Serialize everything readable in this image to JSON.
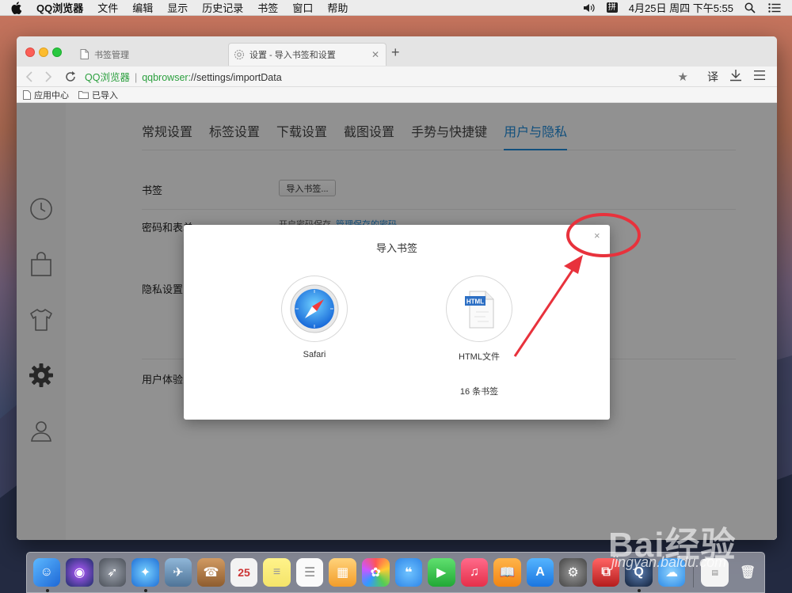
{
  "menubar": {
    "app": "QQ浏览器",
    "menus": [
      "文件",
      "编辑",
      "显示",
      "历史记录",
      "书签",
      "窗口",
      "帮助"
    ],
    "input_method": "拼",
    "clock": "4月25日 周四 下午5:55"
  },
  "tabs": [
    {
      "label": "书签管理",
      "active": false
    },
    {
      "label": "设置 - 导入书签和设置",
      "active": true
    }
  ],
  "toolbar": {
    "site_identity": "QQ浏览器",
    "url_scheme": "qqbrowser:",
    "url_path": "//settings/importData",
    "translate_label": "译"
  },
  "bookmarks_bar": [
    {
      "label": "应用中心"
    },
    {
      "label": "已导入"
    }
  ],
  "settings_tabs": [
    {
      "label": "常规设置",
      "active": false
    },
    {
      "label": "标签设置",
      "active": false
    },
    {
      "label": "下载设置",
      "active": false
    },
    {
      "label": "截图设置",
      "active": false
    },
    {
      "label": "手势与快捷键",
      "active": false
    },
    {
      "label": "用户与隐私",
      "active": true
    }
  ],
  "sections": {
    "bookmarks": {
      "label": "书签",
      "button": "导入书签..."
    },
    "passwords": {
      "label": "密码和表单",
      "checkbox": "开启密码保存",
      "link": "管理保存的密码"
    },
    "privacy": {
      "label": "隐私设置"
    },
    "ux": {
      "label": "用户体验改"
    }
  },
  "dialog": {
    "title": "导入书签",
    "close_symbol": "×",
    "sources": [
      {
        "label": "Safari",
        "icon": "safari-icon"
      },
      {
        "label": "HTML文件",
        "icon": "html-file-icon",
        "badge": "HTML"
      }
    ],
    "count_text": "16 条书签"
  },
  "watermark": {
    "text": "jingyan.baidu.com",
    "logo": "Bai经验"
  },
  "dock": {
    "calendar_day": "25",
    "colors": [
      "#3a8ee6",
      "#444a5c",
      "#7b7f8a",
      "#2f8ded",
      "#6c8fb0",
      "#b88552",
      "#e6e6e6",
      "#f3e79a",
      "#f5f5f5",
      "#f2b24a",
      "#e8e8e8",
      "#3e9be8",
      "#31c24b",
      "#e94a5b",
      "#f59b23",
      "#2d8ce8",
      "#6b6b70",
      "#d23a3a",
      "#1d2f47",
      "#3aa0f0"
    ]
  },
  "accent_color": "#1f8ad8",
  "annotation_color": "#e8323c"
}
